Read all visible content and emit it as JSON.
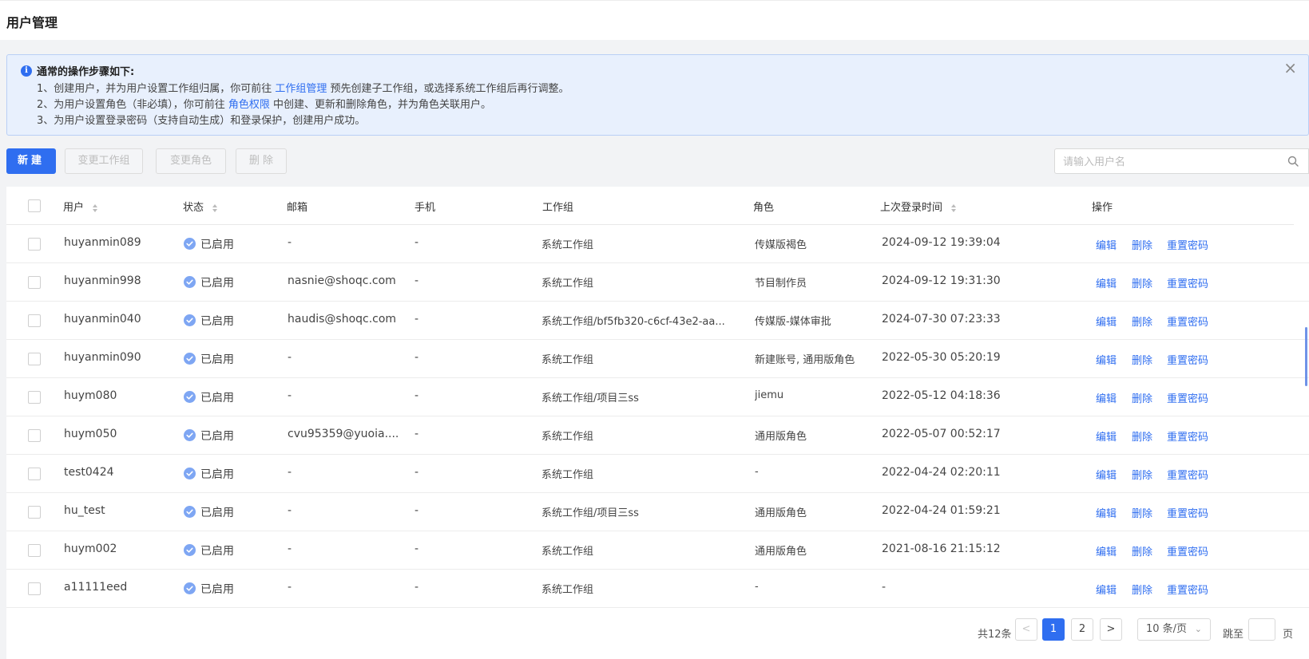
{
  "page": {
    "title": "用户管理"
  },
  "alert": {
    "title": "通常的操作步骤如下:",
    "lines": [
      {
        "before": "1、创建用户，并为用户设置工作组归属，你可前往 ",
        "link": "工作组管理",
        "after": " 预先创建子工作组，或选择系统工作组后再行调整。"
      },
      {
        "before": "2、为用户设置角色（非必填），你可前往 ",
        "link": "角色权限",
        "after": " 中创建、更新和删除角色，并为角色关联用户。"
      },
      {
        "before": "3、为用户设置登录密码（支持自动生成）和登录保护，创建用户成功。",
        "link": "",
        "after": ""
      }
    ],
    "close_icon": "close-icon"
  },
  "toolbar": {
    "new_label": "新建",
    "change_group_label": "变更工作组",
    "change_role_label": "变更角色",
    "delete_label": "删 除",
    "search_placeholder": "请输入用户名"
  },
  "table": {
    "columns": [
      "用户",
      "状态",
      "邮箱",
      "手机",
      "工作组",
      "角色",
      "上次登录时间",
      "操作"
    ],
    "actions": {
      "edit": "编辑",
      "delete": "删除",
      "reset": "重置密码"
    },
    "rows": [
      {
        "user": "huyanmin089",
        "status": "已启用",
        "email": "-",
        "phone": "-",
        "group": "系统工作组",
        "role": "传媒版褐色",
        "last_login": "2024-09-12 19:39:04"
      },
      {
        "user": "huyanmin998",
        "status": "已启用",
        "email": "nasnie@shoqc.com",
        "phone": "-",
        "group": "系统工作组",
        "role": "节目制作员",
        "last_login": "2024-09-12 19:31:30"
      },
      {
        "user": "huyanmin040",
        "status": "已启用",
        "email": "haudis@shoqc.com",
        "phone": "-",
        "group": "系统工作组/bf5fb320-c6cf-43e2-aa...",
        "role": "传媒版-媒体审批",
        "last_login": "2024-07-30 07:23:33"
      },
      {
        "user": "huyanmin090",
        "status": "已启用",
        "email": "-",
        "phone": "-",
        "group": "系统工作组",
        "role": "新建账号, 通用版角色",
        "last_login": "2022-05-30 05:20:19"
      },
      {
        "user": "huym080",
        "status": "已启用",
        "email": "-",
        "phone": "-",
        "group": "系统工作组/项目三ss",
        "role": "jiemu",
        "last_login": "2022-05-12 04:18:36"
      },
      {
        "user": "huym050",
        "status": "已启用",
        "email": "cvu95359@yuoia....",
        "phone": "-",
        "group": "系统工作组",
        "role": "通用版角色",
        "last_login": "2022-05-07 00:52:17"
      },
      {
        "user": "test0424",
        "status": "已启用",
        "email": "-",
        "phone": "-",
        "group": "系统工作组",
        "role": "-",
        "last_login": "2022-04-24 02:20:11"
      },
      {
        "user": "hu_test",
        "status": "已启用",
        "email": "-",
        "phone": "-",
        "group": "系统工作组/项目三ss",
        "role": "通用版角色",
        "last_login": "2022-04-24 01:59:21"
      },
      {
        "user": "huym002",
        "status": "已启用",
        "email": "-",
        "phone": "-",
        "group": "系统工作组",
        "role": "通用版角色",
        "last_login": "2021-08-16 21:15:12"
      },
      {
        "user": "a11111eed",
        "status": "已启用",
        "email": "-",
        "phone": "-",
        "group": "系统工作组",
        "role": "-",
        "last_login": "-"
      }
    ]
  },
  "pagination": {
    "total": "共12条",
    "pages": [
      "1",
      "2"
    ],
    "current": "1",
    "page_size": "10 条/页",
    "jump_label": "跳至",
    "page_label": "页",
    "prev": "<",
    "next": ">"
  },
  "colors": {
    "primary": "#2f6ef0",
    "alert_bg": "#e8f0fd",
    "status_dot": "#7ea6f3"
  }
}
